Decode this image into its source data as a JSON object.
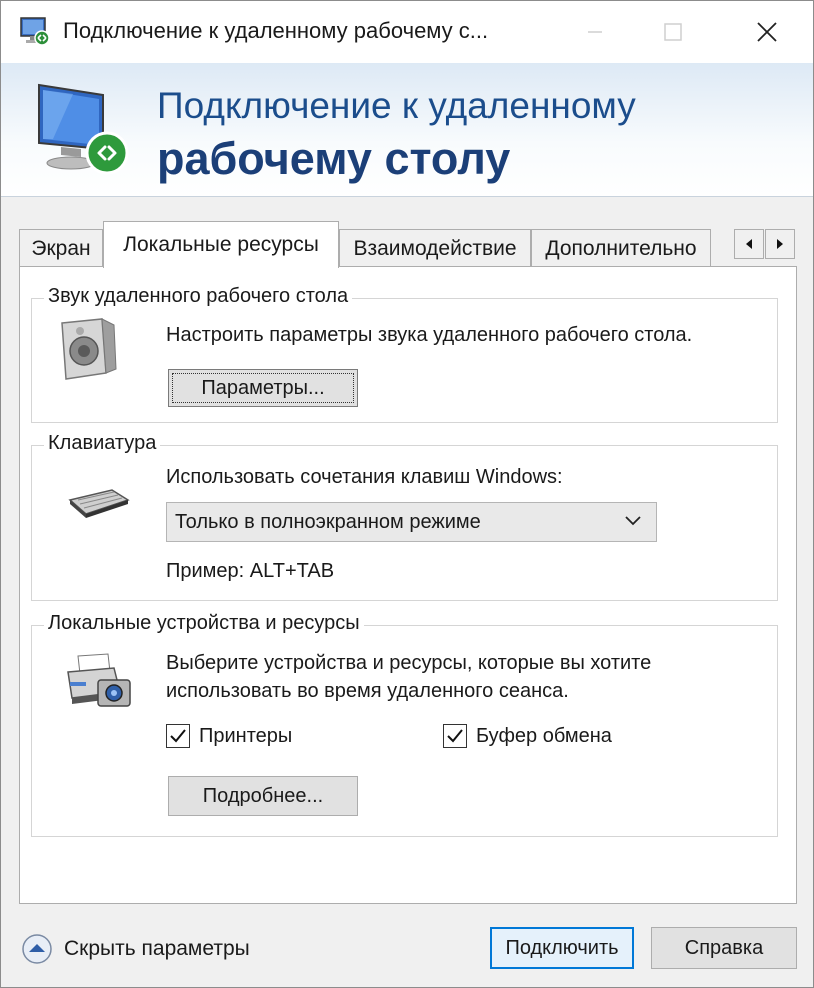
{
  "window": {
    "title": "Подключение к удаленному рабочему с..."
  },
  "banner": {
    "line1": "Подключение к удаленному",
    "line2": "рабочему столу"
  },
  "tabs": [
    {
      "label": "Экран",
      "active": false
    },
    {
      "label": "Локальные ресурсы",
      "active": true
    },
    {
      "label": "Взаимодействие",
      "active": false
    },
    {
      "label": "Дополнительно",
      "active": false
    }
  ],
  "sound": {
    "title": "Звук удаленного рабочего стола",
    "description": "Настроить параметры звука удаленного рабочего стола.",
    "button": "Параметры..."
  },
  "keyboard": {
    "title": "Клавиатура",
    "description": "Использовать сочетания клавиш Windows:",
    "selected": "Только в полноэкранном режиме",
    "example": "Пример: ALT+TAB"
  },
  "devices": {
    "title": "Локальные устройства и ресурсы",
    "description_line1": "Выберите устройства и ресурсы, которые вы хотите",
    "description_line2": "использовать во время удаленного сеанса.",
    "printers_label": "Принтеры",
    "printers_checked": true,
    "clipboard_label": "Буфер обмена",
    "clipboard_checked": true,
    "more_button": "Подробнее..."
  },
  "footer": {
    "hide_options": "Скрыть параметры",
    "connect": "Подключить",
    "help": "Справка"
  },
  "colors": {
    "accent": "#0078d7",
    "banner_text": "#1b4d8c"
  }
}
